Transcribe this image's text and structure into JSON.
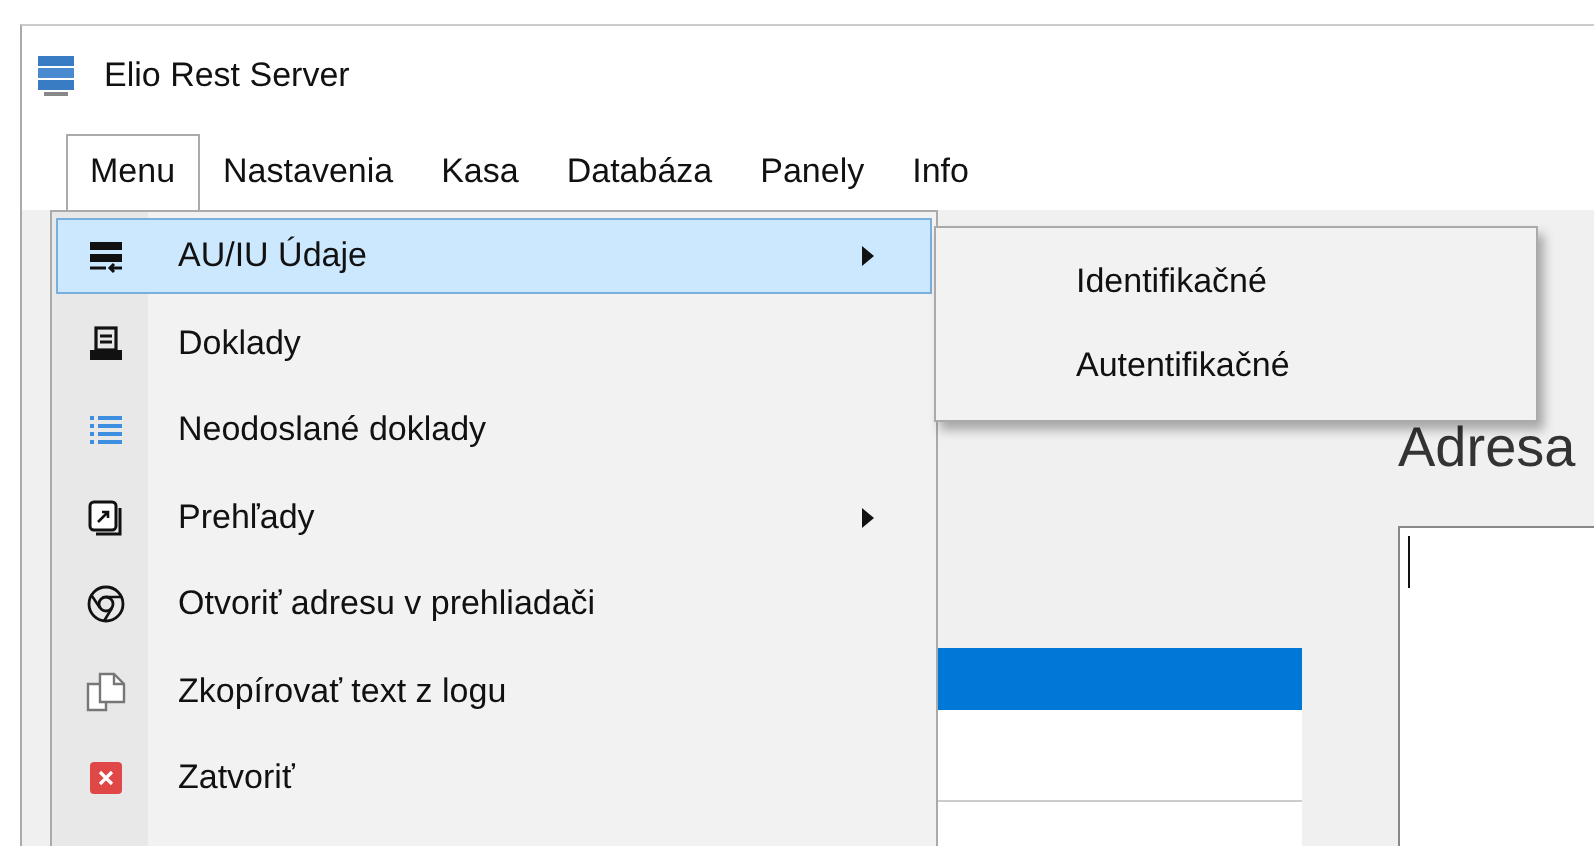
{
  "window": {
    "title": "Elio Rest Server"
  },
  "menubar": [
    {
      "label": "Menu",
      "selected": true
    },
    {
      "label": "Nastavenia",
      "selected": false
    },
    {
      "label": "Kasa",
      "selected": false
    },
    {
      "label": "Databáza",
      "selected": false
    },
    {
      "label": "Panely",
      "selected": false
    },
    {
      "label": "Info",
      "selected": false
    }
  ],
  "dropdown": [
    {
      "label": "AU/IU Údaje",
      "kind": "server",
      "submenu": true,
      "selected": true
    },
    {
      "label": "Doklady",
      "kind": "printer",
      "submenu": false,
      "selected": false
    },
    {
      "label": "Neodoslané doklady",
      "kind": "list",
      "submenu": false,
      "selected": false
    },
    {
      "label": "Prehľady",
      "kind": "report",
      "submenu": true,
      "selected": false
    },
    {
      "label": "Otvoriť adresu v prehliadači",
      "kind": "browser",
      "submenu": false,
      "selected": false
    },
    {
      "label": "Zkopírovať text z logu",
      "kind": "copy",
      "submenu": false,
      "selected": false
    },
    {
      "label": "Zatvoriť",
      "kind": "close",
      "submenu": false,
      "selected": false
    }
  ],
  "submenu": [
    "Identifikačné",
    "Autentifikačné"
  ],
  "content": {
    "address_label": "Adresa",
    "list_rows": [
      {
        "selected": true
      },
      {
        "selected": false
      },
      {
        "selected": false
      }
    ]
  }
}
